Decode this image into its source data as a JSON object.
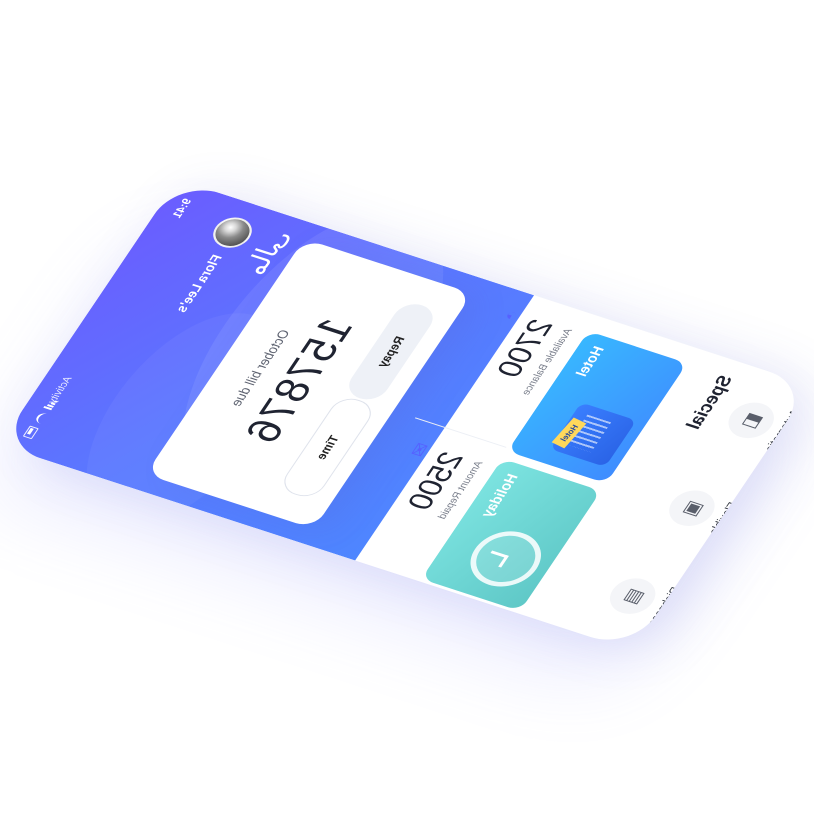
{
  "status": {
    "time": "9:41",
    "activity": "Activity"
  },
  "profile": {
    "name": "Flora Lee's",
    "arabic_label": "مالی"
  },
  "bill": {
    "title": "October bill due",
    "amount": "157876",
    "repay_label": "Repay",
    "time_label": "Time"
  },
  "stats": {
    "available_balance_value": "2700",
    "available_balance_label": "Available Balance",
    "amount_repaid_value": "2500",
    "amount_repaid_label": "Amount Repaid"
  },
  "cards": {
    "hotel_title": "Hotel",
    "hotel_sign": "Hotel",
    "holiday_title": "Holiday",
    "next_title": "Holiday"
  },
  "special": {
    "title": "Special",
    "items": [
      {
        "label": "Automatic",
        "icon": "bag-icon"
      },
      {
        "label": "Flexible",
        "icon": "voucher-icon"
      },
      {
        "label": "Richness",
        "icon": "wallet-icon"
      }
    ]
  }
}
